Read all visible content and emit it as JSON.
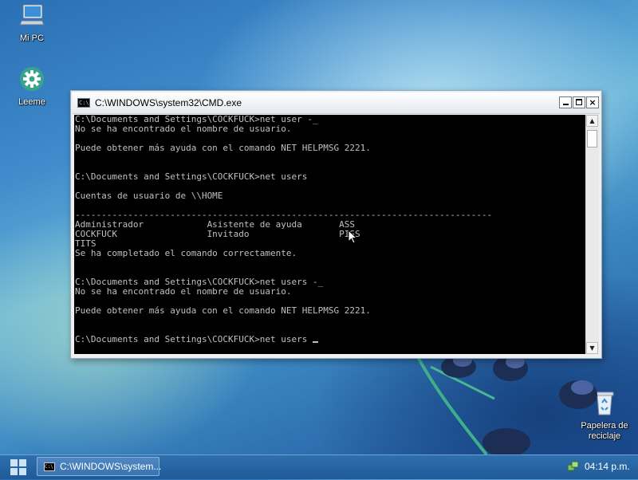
{
  "desktop": {
    "icons": [
      {
        "label": "Mi PC",
        "icon": "computer-icon"
      },
      {
        "label": "Leeme",
        "icon": "gear-icon"
      },
      {
        "label": "Papelera de reciclaje",
        "icon": "recycle-bin-icon"
      }
    ]
  },
  "cmd_window": {
    "title": "C:\\WINDOWS\\system32\\CMD.exe",
    "console_lines": [
      "C:\\Documents and Settings\\COCKFUCK>net user -_",
      "No se ha encontrado el nombre de usuario.",
      "",
      "Puede obtener más ayuda con el comando NET HELPMSG 2221.",
      "",
      "",
      "C:\\Documents and Settings\\COCKFUCK>net users",
      "",
      "Cuentas de usuario de \\\\HOME",
      "",
      "-------------------------------------------------------------------------------",
      "Administrador            Asistente de ayuda       ASS",
      "COCKFUCK                 Invitado                 PISS",
      "TITS",
      "Se ha completado el comando correctamente.",
      "",
      "",
      "C:\\Documents and Settings\\COCKFUCK>net users -_",
      "No se ha encontrado el nombre de usuario.",
      "",
      "Puede obtener más ayuda con el comando NET HELPMSG 2221.",
      "",
      "",
      "C:\\Documents and Settings\\COCKFUCK>net users "
    ],
    "buttons": {
      "minimize": "minimize",
      "maximize": "maximize",
      "close": "×"
    }
  },
  "taskbar": {
    "task_label": "C:\\WINDOWS\\system...",
    "clock": "04:14 p.m."
  }
}
